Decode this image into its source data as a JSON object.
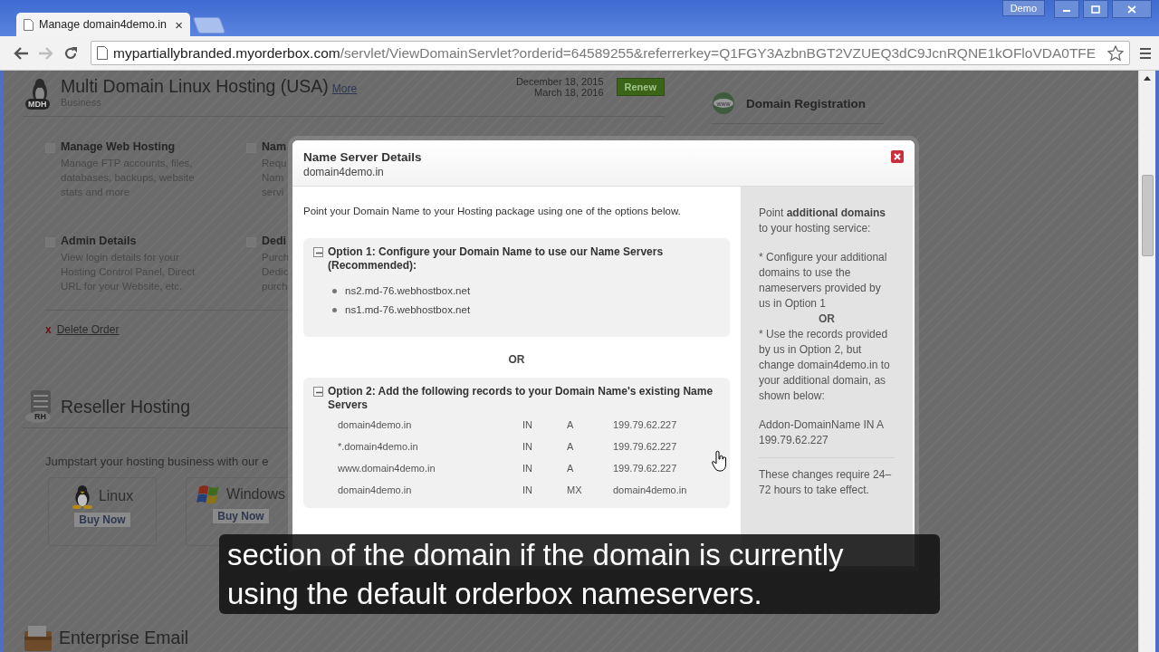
{
  "browser": {
    "tab": {
      "title": "Manage domain4demo.in",
      "close": "×"
    },
    "user": "Demo",
    "url": {
      "host": "mypartiallybranded.myorderbox.com",
      "path": "/servlet/ViewDomainServlet?orderid=64589255&referrerkey=Q1FGY3AzbnBGT2VZUEQ3dC9JcnRQNE1kOFloVDA0TFE"
    }
  },
  "page": {
    "product": {
      "badge": "MDH",
      "title": "Multi Domain Linux Hosting (USA)",
      "more": "More",
      "plan": "Business",
      "dates": [
        "December 18, 2015",
        "March 18, 2016"
      ],
      "renew": "Renew"
    },
    "actions": [
      {
        "title": "Manage Web Hosting",
        "description": "Manage FTP accounts, files, databases, backups, website stats and more"
      },
      {
        "title": "Nam",
        "description": "Requ Nam servi"
      },
      {
        "title": "Admin Details",
        "description": "View login details for your Hosting Control Panel, Direct URL for your Website, etc."
      },
      {
        "title": "Dedi",
        "description": "Purch Dedic purch"
      }
    ],
    "delete_order": {
      "mark": "x",
      "label": "Delete Order"
    },
    "reseller": {
      "badge": "RH",
      "title": "Reseller Hosting",
      "intro": "Jumpstart your hosting business with our e",
      "plans": [
        {
          "kind": "linux",
          "name": "Linux",
          "button": "Buy Now"
        },
        {
          "kind": "windows",
          "name": "Windows",
          "button": "Buy Now"
        }
      ]
    },
    "email": {
      "title": "Enterprise Email"
    },
    "sidebar": {
      "top": [
        {
          "kind": "globe",
          "badge": "www",
          "label": "Domain Registration"
        }
      ]
    }
  },
  "dialog": {
    "title": "Name Server Details",
    "subtitle": "domain4demo.in",
    "intro": "Point your Domain Name to your Hosting package using one of the options below.",
    "options": [
      {
        "kind": "nameservers",
        "expanded": true,
        "title": "Option 1: Configure your Domain Name to use our Name Servers (Recommended):",
        "nameservers": [
          "ns2.md-76.webhostbox.net",
          "ns1.md-76.webhostbox.net"
        ]
      },
      {
        "kind": "records",
        "expanded": true,
        "title": "Option 2: Add the following records to your Domain Name's existing Name Servers",
        "records": [
          {
            "host": "domain4demo.in",
            "class": "IN",
            "type": "A",
            "value": "199.79.62.227"
          },
          {
            "host": "*.domain4demo.in",
            "class": "IN",
            "type": "A",
            "value": "199.79.62.227"
          },
          {
            "host": "www.domain4demo.in",
            "class": "IN",
            "type": "A",
            "value": "199.79.62.227"
          },
          {
            "host": "domain4demo.in",
            "class": "IN",
            "type": "MX",
            "value": "domain4demo.in"
          }
        ]
      }
    ],
    "separator": "OR",
    "aside": {
      "intro": "Point **additional domains** to your hosting service:",
      "steps": [
        "* Configure your additional domains to use the nameservers provided by us in Option 1",
        "* Use the records provided by us in Option 2, but change domain4demo.in to your additional domain, as shown below:"
      ],
      "separator": "OR",
      "example": "Addon-DomainName IN A 199.79.62.227",
      "note": "These changes require 24–72 hours to take effect."
    }
  },
  "caption": {
    "lines": [
      "section of the domain if the domain is currently",
      "using the default orderbox nameservers."
    ]
  }
}
